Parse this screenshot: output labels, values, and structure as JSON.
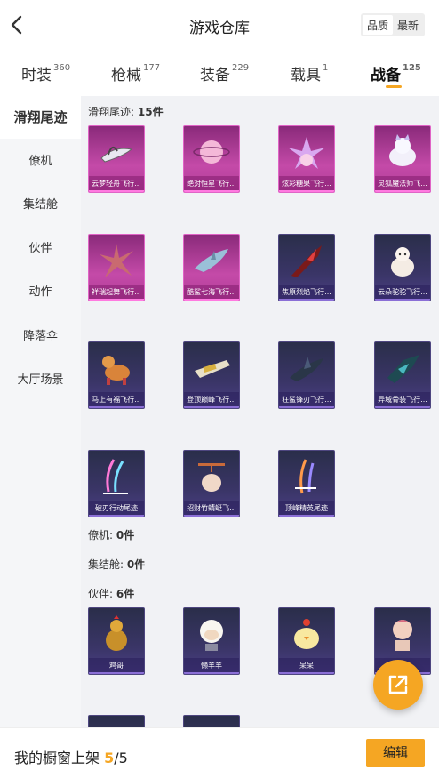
{
  "header": {
    "title": "游戏仓库",
    "sort_options": [
      "品质",
      "最新"
    ],
    "back_icon": "chevron-left-icon"
  },
  "tabs": [
    {
      "label": "时装",
      "count": "360"
    },
    {
      "label": "枪械",
      "count": "177"
    },
    {
      "label": "装备",
      "count": "229"
    },
    {
      "label": "载具",
      "count": "1"
    },
    {
      "label": "战备",
      "count": "125"
    }
  ],
  "active_tab": "战备",
  "sidebar": {
    "items": [
      "滑翔尾迹",
      "僚机",
      "集结舱",
      "伙伴",
      "动作",
      "降落伞",
      "大厅场景"
    ],
    "active": "滑翔尾迹"
  },
  "sections": [
    {
      "label": "滑翔尾迹:",
      "count": "15件"
    },
    {
      "label": "僚机:",
      "count": "0件"
    },
    {
      "label": "集结舱:",
      "count": "0件"
    },
    {
      "label": "伙伴:",
      "count": "6件"
    }
  ],
  "glide_items": [
    {
      "name": "云梦轻舟飞行...",
      "rarity": "pink"
    },
    {
      "name": "绝对恒星飞行...",
      "rarity": "pink"
    },
    {
      "name": "炫彩糖果飞行...",
      "rarity": "pink"
    },
    {
      "name": "灵狐魔法师飞...",
      "rarity": "pink"
    },
    {
      "name": "祥瑞起舞飞行...",
      "rarity": "pink"
    },
    {
      "name": "酷鲨七海飞行...",
      "rarity": "pink"
    },
    {
      "name": "焦原烈焰飞行...",
      "rarity": "purple"
    },
    {
      "name": "云朵驼驼飞行...",
      "rarity": "purple"
    },
    {
      "name": "马上有福飞行...",
      "rarity": "purple"
    },
    {
      "name": "登顶巅峰飞行...",
      "rarity": "purple"
    },
    {
      "name": "狂鲨锋刃飞行...",
      "rarity": "purple"
    },
    {
      "name": "异域骨装飞行...",
      "rarity": "purple"
    },
    {
      "name": "破刃行动尾迹",
      "rarity": "purple"
    },
    {
      "name": "招财竹蜻蜓飞...",
      "rarity": "purple"
    },
    {
      "name": "顶峰精英尾迹",
      "rarity": "purple"
    }
  ],
  "partner_items": [
    {
      "name": "鸡哥",
      "rarity": "purple"
    },
    {
      "name": "懒羊羊",
      "rarity": "purple"
    },
    {
      "name": "呆呆",
      "rarity": "purple"
    },
    {
      "name": "",
      "rarity": "purple"
    },
    {
      "name": "",
      "rarity": "purple"
    },
    {
      "name": "",
      "rarity": "purple"
    }
  ],
  "fab_icon": "share-external-icon",
  "bottom": {
    "prefix": "我的橱窗上架",
    "current": "5",
    "total": "/5",
    "edit_label": "编辑"
  },
  "colors": {
    "accent": "#f5a623",
    "pink_card": "#c44aa8",
    "purple_card": "#3a3567"
  }
}
